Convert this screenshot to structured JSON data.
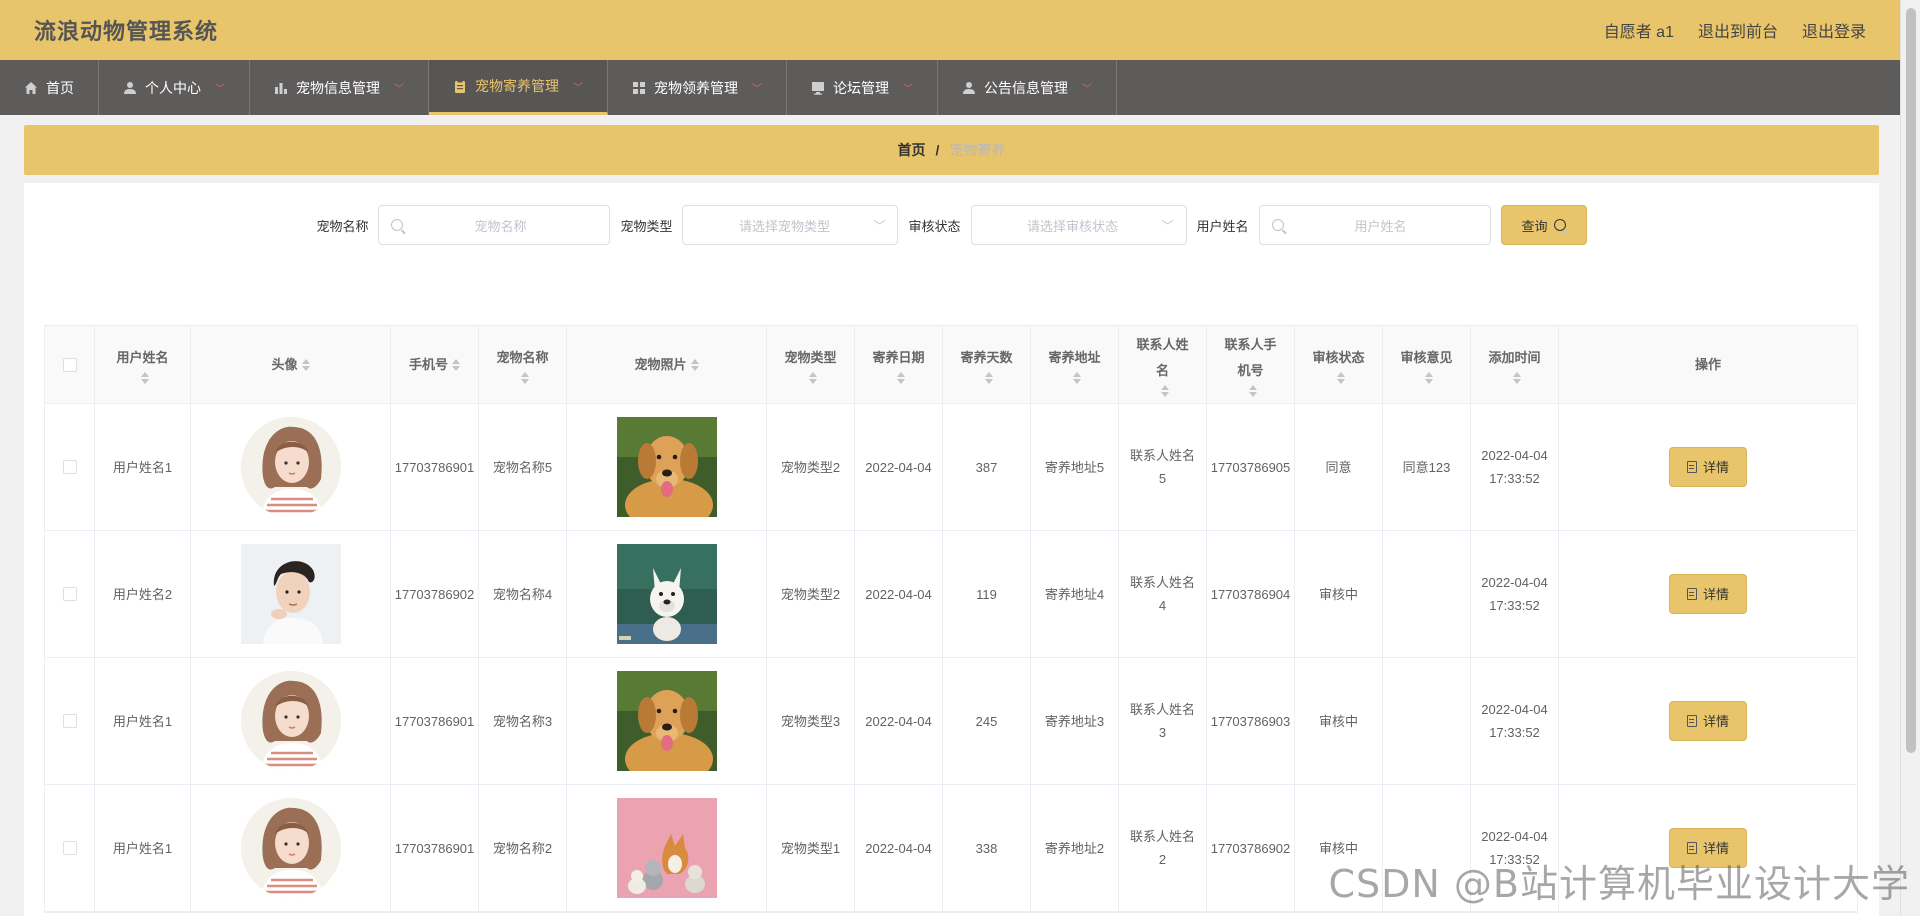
{
  "app": {
    "title": "流浪动物管理系统",
    "user_label": "自愿者 a1",
    "front_link": "退出到前台",
    "logout_link": "退出登录"
  },
  "nav": [
    {
      "label": "首页",
      "icon": "home-icon"
    },
    {
      "label": "个人中心",
      "icon": "user-icon"
    },
    {
      "label": "宠物信息管理",
      "icon": "bar-chart-icon"
    },
    {
      "label": "宠物寄养管理",
      "icon": "clipboard-icon",
      "active": true
    },
    {
      "label": "宠物领养管理",
      "icon": "grid-icon"
    },
    {
      "label": "论坛管理",
      "icon": "monitor-icon"
    },
    {
      "label": "公告信息管理",
      "icon": "user-icon"
    }
  ],
  "breadcrumb": {
    "home": "首页",
    "sep": "/",
    "current": "宠物寄养"
  },
  "search": {
    "pet_name_label": "宠物名称",
    "pet_name_placeholder": "宠物名称",
    "pet_type_label": "宠物类型",
    "pet_type_placeholder": "请选择宠物类型",
    "review_label": "审核状态",
    "review_placeholder": "请选择审核状态",
    "user_name_label": "用户姓名",
    "user_name_placeholder": "用户姓名",
    "query_button": "查询"
  },
  "table": {
    "headers": {
      "user_name": "用户姓名",
      "avatar": "头像",
      "phone": "手机号",
      "pet_name": "宠物名称",
      "pet_photo": "宠物照片",
      "pet_type": "宠物类型",
      "foster_date": "寄养日期",
      "foster_days": "寄养天数",
      "foster_address": "寄养地址",
      "contact_name": "联系人姓名",
      "contact_phone": "联系人手机号",
      "review_status": "审核状态",
      "review_comment": "审核意见",
      "added_time": "添加时间",
      "actions": "操作"
    },
    "detail_button": "详情",
    "rows": [
      {
        "user_name": "用户姓名1",
        "avatar": "woman",
        "phone": "17703786901",
        "pet_name": "宠物名称5",
        "pet_photo": "golden-retriever",
        "pet_type": "宠物类型2",
        "foster_date": "2022-04-04",
        "foster_days": "387",
        "foster_address": "寄养地址5",
        "contact_name": "联系人姓名5",
        "contact_phone": "17703786905",
        "review_status": "同意",
        "review_comment": "同意123",
        "added_time": "2022-04-04 17:33:52"
      },
      {
        "user_name": "用户姓名2",
        "avatar": "man",
        "phone": "17703786902",
        "pet_name": "宠物名称4",
        "pet_photo": "husky",
        "pet_type": "宠物类型2",
        "foster_date": "2022-04-04",
        "foster_days": "119",
        "foster_address": "寄养地址4",
        "contact_name": "联系人姓名4",
        "contact_phone": "17703786904",
        "review_status": "审核中",
        "review_comment": "",
        "added_time": "2022-04-04 17:33:52"
      },
      {
        "user_name": "用户姓名1",
        "avatar": "woman",
        "phone": "17703786901",
        "pet_name": "宠物名称3",
        "pet_photo": "golden-retriever",
        "pet_type": "宠物类型3",
        "foster_date": "2022-04-04",
        "foster_days": "245",
        "foster_address": "寄养地址3",
        "contact_name": "联系人姓名3",
        "contact_phone": "17703786903",
        "review_status": "审核中",
        "review_comment": "",
        "added_time": "2022-04-04 17:33:52"
      },
      {
        "user_name": "用户姓名1",
        "avatar": "woman",
        "phone": "17703786901",
        "pet_name": "宠物名称2",
        "pet_photo": "pets-group-pink",
        "pet_type": "宠物类型1",
        "foster_date": "2022-04-04",
        "foster_days": "338",
        "foster_address": "寄养地址2",
        "contact_name": "联系人姓名2",
        "contact_phone": "17703786902",
        "review_status": "审核中",
        "review_comment": "",
        "added_time": "2022-04-04 17:33:52"
      }
    ]
  },
  "watermark": "CSDN @B站计算机毕业设计大学"
}
